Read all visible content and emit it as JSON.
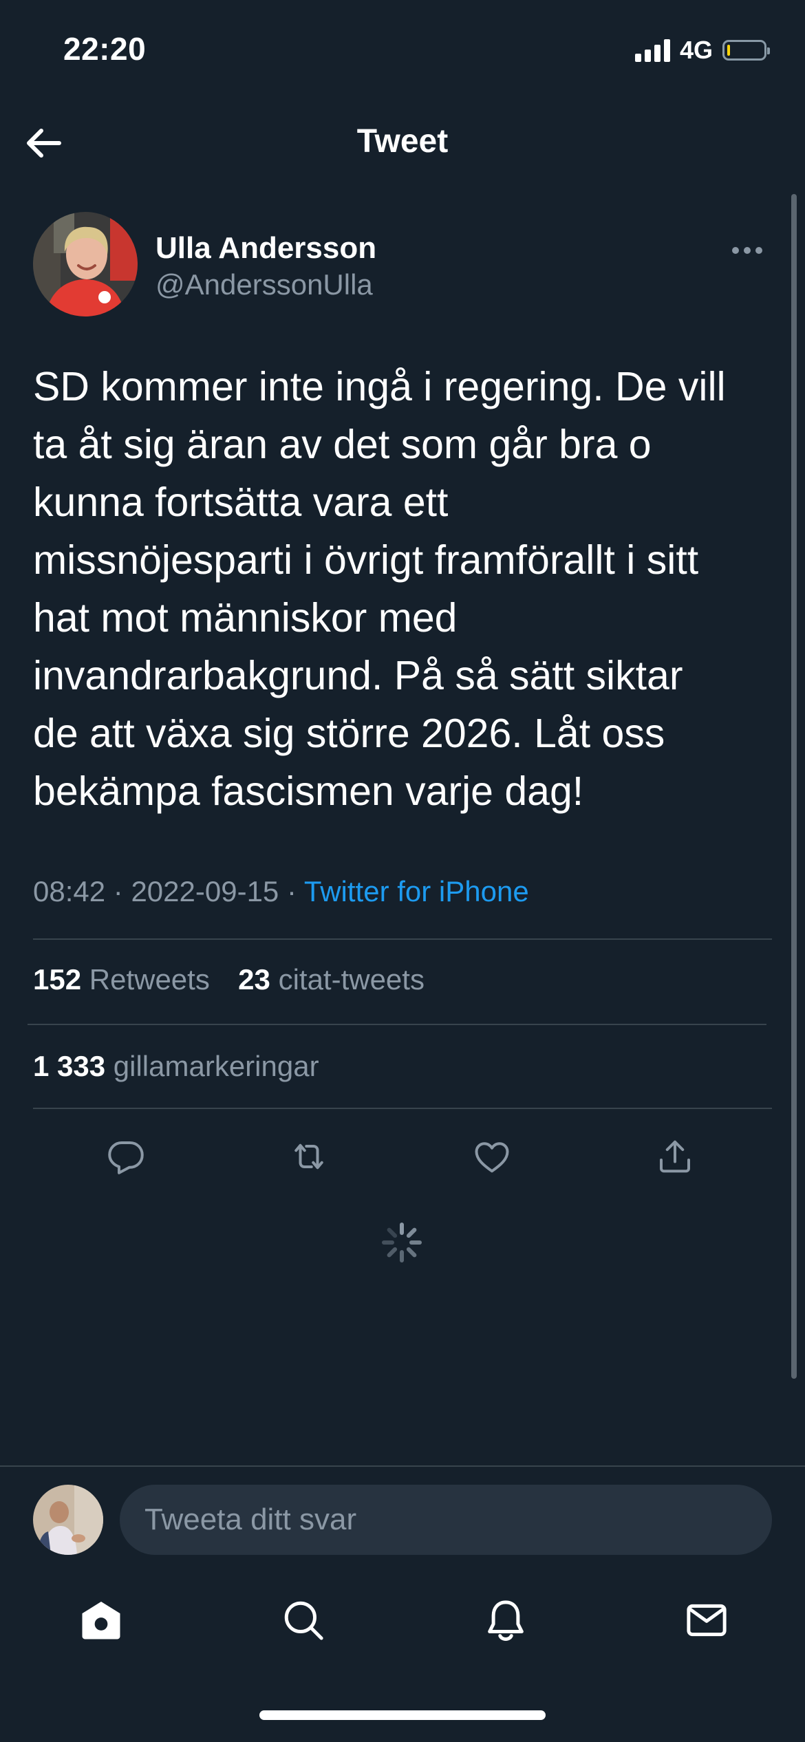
{
  "status_bar": {
    "time": "22:20",
    "network": "4G",
    "battery_level": 0.05,
    "battery_fill_color": "#ffd60a"
  },
  "header": {
    "title": "Tweet",
    "back_icon": "arrow-left-icon"
  },
  "author": {
    "name": "Ulla Andersson",
    "handle": "@AnderssonUlla",
    "more_icon": "more-horizontal-icon"
  },
  "tweet": {
    "text_lines": [
      "SD kommer inte ingå i regering. De vill",
      "ta åt sig äran av det som går bra o",
      "kunna fortsätta vara ett",
      "missnöjesparti i övrigt framförallt i sitt",
      "hat mot människor med",
      "invandrarbakgrund. På så sätt siktar",
      "de att växa sig större 2026. Låt oss",
      "bekämpa fascismen varje dag!"
    ],
    "time": "08:42",
    "date": "2022-09-15",
    "separator": "·",
    "source": "Twitter for iPhone"
  },
  "stats": {
    "retweets_count": "152",
    "retweets_label": "Retweets",
    "quotes_count": "23",
    "quotes_label": "citat-tweets",
    "likes_count": "1 333",
    "likes_label": "gillamarkeringar"
  },
  "actions": {
    "reply_icon": "reply-icon",
    "retweet_icon": "retweet-icon",
    "like_icon": "heart-icon",
    "share_icon": "share-icon"
  },
  "reply": {
    "placeholder": "Tweeta ditt svar"
  },
  "tab_bar": {
    "items": [
      "home-icon",
      "search-icon",
      "notifications-icon",
      "messages-icon"
    ]
  },
  "colors": {
    "background": "#15202b",
    "accent": "#1d9bf0",
    "secondary_text": "#8b98a5",
    "divider": "#38444d"
  }
}
